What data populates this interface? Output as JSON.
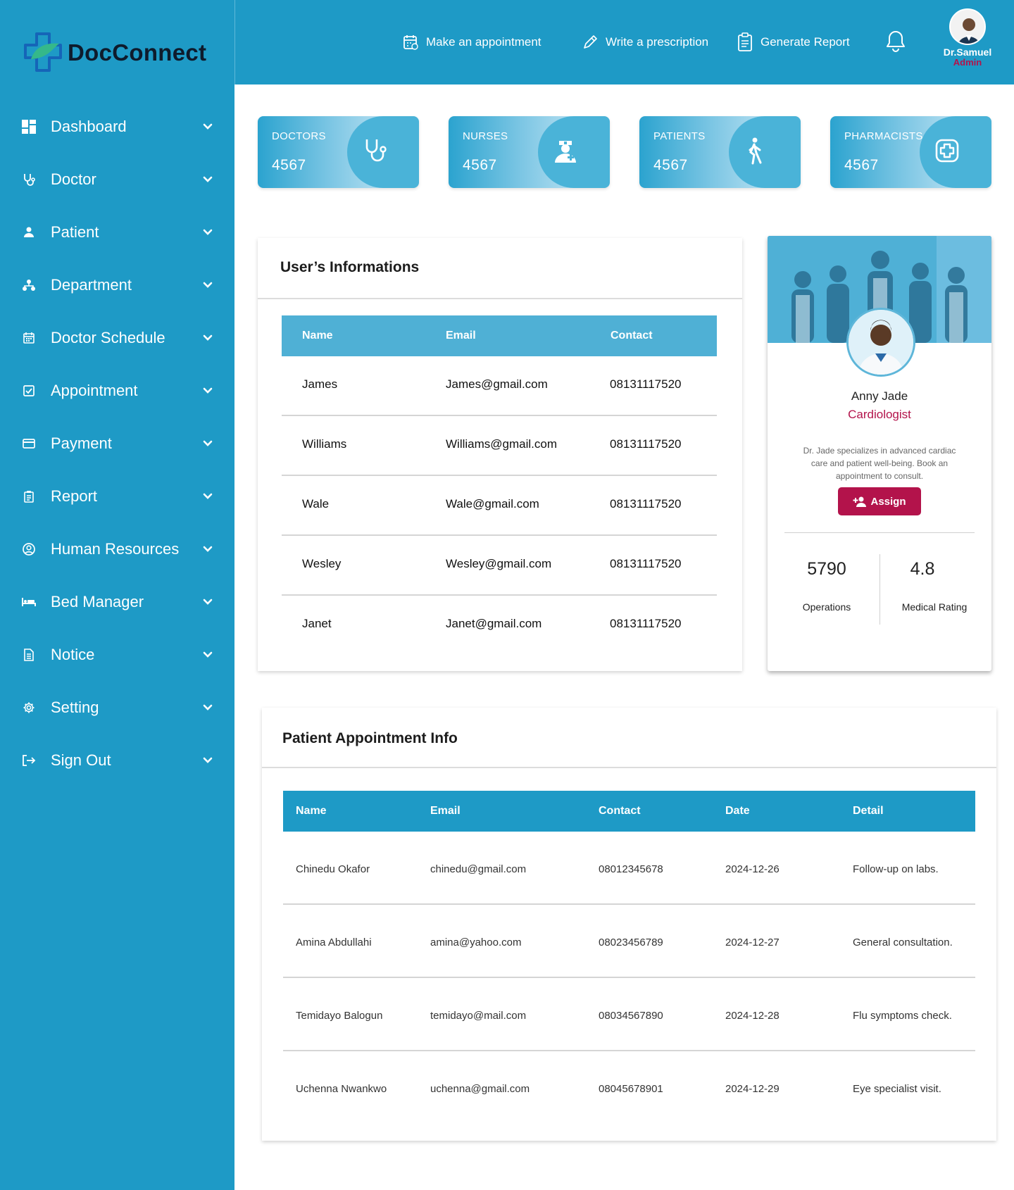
{
  "brand": {
    "name": "DocConnect"
  },
  "sidebar": {
    "items": [
      {
        "label": "Dashboard",
        "icon": "dashboard-icon"
      },
      {
        "label": "Doctor",
        "icon": "stethoscope-icon"
      },
      {
        "label": "Patient",
        "icon": "person-icon"
      },
      {
        "label": "Department",
        "icon": "sitemap-icon"
      },
      {
        "label": "Doctor Schedule",
        "icon": "calendar-icon"
      },
      {
        "label": "Appointment",
        "icon": "checkbox-icon"
      },
      {
        "label": "Payment",
        "icon": "credit-card-icon"
      },
      {
        "label": "Report",
        "icon": "clipboard-icon"
      },
      {
        "label": "Human Resources",
        "icon": "user-circle-icon"
      },
      {
        "label": "Bed Manager",
        "icon": "bed-icon"
      },
      {
        "label": "Notice",
        "icon": "document-icon"
      },
      {
        "label": "Setting",
        "icon": "gear-icon"
      },
      {
        "label": "Sign Out",
        "icon": "sign-out-icon"
      }
    ]
  },
  "header": {
    "make_appointment": "Make an appointment",
    "write_prescription": "Write a prescription",
    "generate_report": "Generate Report",
    "user_name": "Dr.Samuel",
    "user_role": "Admin"
  },
  "stats": [
    {
      "label": "DOCTORS",
      "value": "4567",
      "icon": "stethoscope-icon"
    },
    {
      "label": "NURSES",
      "value": "4567",
      "icon": "nurse-icon"
    },
    {
      "label": "PATIENTS",
      "value": "4567",
      "icon": "walking-person-icon"
    },
    {
      "label": "PHARMACISTS",
      "value": "4567",
      "icon": "medical-cross-icon"
    }
  ],
  "users": {
    "title": "User’s Informations",
    "columns": [
      "Name",
      "Email",
      "Contact"
    ],
    "rows": [
      {
        "name": "James",
        "email": "James@gmail.com",
        "contact": "08131117520"
      },
      {
        "name": "Williams",
        "email": "Williams@gmail.com",
        "contact": "08131117520"
      },
      {
        "name": "Wale",
        "email": "Wale@gmail.com",
        "contact": "08131117520"
      },
      {
        "name": "Wesley",
        "email": "Wesley@gmail.com",
        "contact": "08131117520"
      },
      {
        "name": "Janet",
        "email": "Janet@gmail.com",
        "contact": "08131117520"
      }
    ]
  },
  "doctor_card": {
    "name": "Anny Jade",
    "specialty": "Cardiologist",
    "description": "Dr. Jade specializes in advanced cardiac care and patient well-being. Book an appointment to consult.",
    "assign_label": "Assign",
    "operations_value": "5790",
    "operations_label": "Operations",
    "rating_value": "4.8",
    "rating_label": "Medical Rating"
  },
  "appointments": {
    "title": "Patient Appointment Info",
    "columns": [
      "Name",
      "Email",
      "Contact",
      "Date",
      "Detail"
    ],
    "rows": [
      {
        "name": "Chinedu Okafor",
        "email": "chinedu@gmail.com",
        "contact": "08012345678",
        "date": "2024-12-26",
        "detail": "Follow-up on labs."
      },
      {
        "name": "Amina Abdullahi",
        "email": "amina@yahoo.com",
        "contact": "08023456789",
        "date": "2024-12-27",
        "detail": "General consultation."
      },
      {
        "name": "Temidayo Balogun",
        "email": "temidayo@mail.com",
        "contact": "08034567890",
        "date": "2024-12-28",
        "detail": "Flu symptoms check."
      },
      {
        "name": "Uchenna Nwankwo",
        "email": "uchenna@gmail.com",
        "contact": "08045678901",
        "date": "2024-12-29",
        "detail": "Eye specialist visit."
      }
    ]
  },
  "colors": {
    "primary": "#1e9ac6",
    "accent": "#b3134b",
    "table_header_light": "#4fb0d5",
    "logo_green": "#35b88a",
    "logo_blue": "#1565b8"
  }
}
